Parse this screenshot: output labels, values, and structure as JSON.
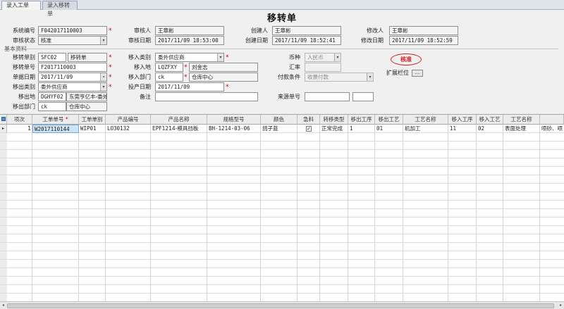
{
  "tabs": [
    {
      "label": "录入工单"
    },
    {
      "label": "录入移转单"
    }
  ],
  "title": "移转单",
  "header": {
    "system_no": {
      "label": "系统编号",
      "value": "F042017110003"
    },
    "audit_status": {
      "label": "审核状态",
      "value": "核准"
    },
    "auditor": {
      "label": "审核人",
      "value": "王章彬"
    },
    "audit_date": {
      "label": "审核日期",
      "value": "2017/11/09 18:53:00"
    },
    "creator": {
      "label": "创建人",
      "value": "王章彬"
    },
    "create_date": {
      "label": "创建日期",
      "value": "2017/11/09 18:52:41"
    },
    "modifier": {
      "label": "修改人",
      "value": "王章彬"
    },
    "modify_date": {
      "label": "修改日期",
      "value": "2017/11/09 18:52:59"
    }
  },
  "section_label": "基本资料",
  "basic": {
    "transfer_type": {
      "label": "移转单别",
      "code": "SFC02",
      "name": "移转单"
    },
    "transfer_no": {
      "label": "移转单号",
      "value": "F2017110003"
    },
    "doc_date": {
      "label": "单据日期",
      "value": "2017/11/09"
    },
    "out_type": {
      "label": "移出类别",
      "value": "委外供应商"
    },
    "out_place": {
      "label": "移出地",
      "code": "DGHYF02",
      "name": "东莞亨亿丰-委外"
    },
    "out_dept": {
      "label": "移出部门",
      "code": "ck",
      "name": "仓库中心"
    },
    "in_type": {
      "label": "移入类别",
      "value": "委外供应商"
    },
    "in_place": {
      "label": "移入地",
      "code": "LQZFXY",
      "name": "刘金志"
    },
    "in_dept": {
      "label": "移入部门",
      "code": "ck",
      "name": "仓库中心"
    },
    "input_date": {
      "label": "投产日期",
      "value": "2017/11/09"
    },
    "remark": {
      "label": "备注",
      "value": ""
    },
    "currency": {
      "label": "币种",
      "value": "人民币"
    },
    "rate": {
      "label": "汇率",
      "value": ""
    },
    "pay_terms": {
      "label": "付款条件",
      "value": "收票付款"
    },
    "source_no": {
      "label": "来源单号",
      "value": ""
    },
    "ext": {
      "label": "扩展栏位",
      "button": "..."
    },
    "stamp": "核准"
  },
  "grid": {
    "columns": [
      "项次",
      "工单单号",
      "工单单别",
      "产品编号",
      "产品名称",
      "规格型号",
      "颜色",
      "急料",
      "转移类型",
      "移出工序",
      "移出工艺",
      "工艺名称",
      "移入工序",
      "移入工艺",
      "工艺名称"
    ],
    "rows": [
      {
        "seq": "1",
        "wo_no": "W2017110144",
        "wo_type": "WIP01",
        "prod_no": "LO30132",
        "prod_name": "EPF1214-模具挡板",
        "spec": "BH-1214-03-06",
        "color": "鸽子蓝",
        "urgent": true,
        "transfer_type": "正常完成",
        "out_proc": "1",
        "out_craft": "01",
        "craft_name": "机加工",
        "in_proc": "11",
        "in_craft": "02",
        "in_craft_name": "表面处理",
        "extra": "喷砂、喷"
      }
    ]
  }
}
